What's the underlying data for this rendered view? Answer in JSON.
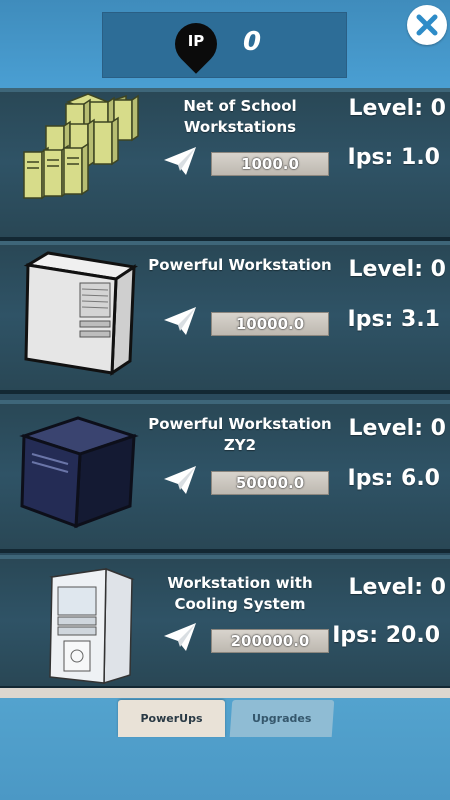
{
  "header": {
    "currency_label": "IP",
    "currency_value": "0",
    "close_icon": "close-icon"
  },
  "items": [
    {
      "title_lines": [
        "Net of School",
        "Workstations"
      ],
      "level": "Level: 0",
      "price": "1000.0",
      "ips": "Ips: 1.0",
      "illustration": "school-workstations-illustration"
    },
    {
      "title_lines": [
        "Powerful Workstation"
      ],
      "level": "Level: 0",
      "price": "10000.0",
      "ips": "Ips: 3.1",
      "illustration": "white-workstation-illustration"
    },
    {
      "title_lines": [
        "Powerful Workstation",
        "ZY2"
      ],
      "level": "Level: 0",
      "price": "50000.0",
      "ips": "Ips: 6.0",
      "illustration": "dark-workstation-illustration"
    },
    {
      "title_lines": [
        "Workstation with",
        "Cooling System"
      ],
      "level": "Level: 0",
      "price": "200000.0",
      "ips": "Ips: 20.0",
      "illustration": "cooled-workstation-illustration"
    }
  ],
  "tabs": [
    {
      "label": "PowerUps",
      "active": true
    },
    {
      "label": "Upgrades",
      "active": false
    }
  ],
  "icons": {
    "buy": "paper-plane-icon",
    "close": "close-icon"
  },
  "colors": {
    "topbar": "#4a9fd3",
    "card_bg": "#2f5366",
    "accent": "#3f8cbc"
  }
}
